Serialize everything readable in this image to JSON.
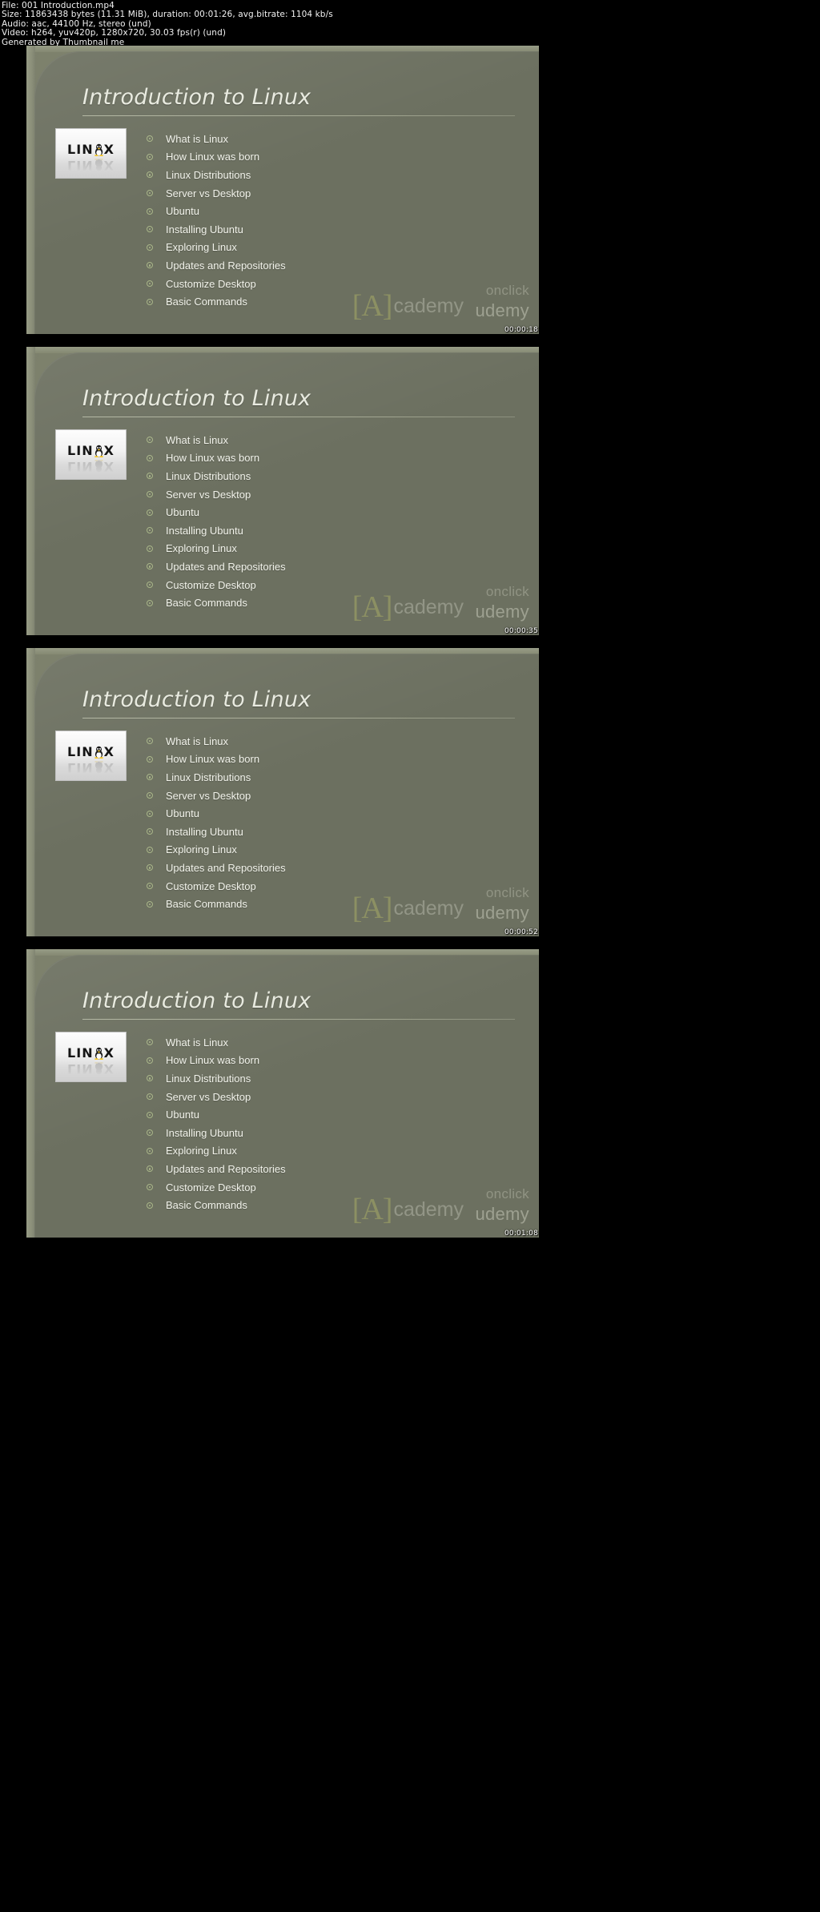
{
  "header": {
    "lines": [
      "File: 001 Introduction.mp4",
      "Size: 11863438 bytes (11.31 MiB), duration: 00:01:26, avg.bitrate: 1104 kb/s",
      "Audio: aac, 44100 Hz, stereo (und)",
      "Video: h264, yuv420p, 1280x720, 30.03 fps(r) (und)",
      "Generated by Thumbnail me"
    ],
    "file_name": "001 Introduction.mp4",
    "size_bytes": "11863438 bytes",
    "size_human": "11.31 MiB",
    "duration": "00:01:26",
    "avg_bitrate": "1104 kb/s",
    "audio_codec": "aac",
    "audio_sample_rate": "44100 Hz",
    "audio_channels": "stereo (und)",
    "video_codec": "h264",
    "pixel_format": "yuv420p",
    "resolution": "1280x720",
    "fps": "30.03 fps(r) (und)",
    "generator": "Generated by Thumbnail me"
  },
  "slide": {
    "title": "Introduction to Linux",
    "logo_word_prefix": "LIN",
    "logo_word_suffix": "X",
    "logo_alt": "linux-logo",
    "bullets": [
      "What is Linux",
      "How Linux was born",
      "Linux Distributions",
      "Server vs Desktop",
      "Ubuntu",
      "Installing Ubuntu",
      "Exploring Linux",
      "Updates and Repositories",
      "Customize Desktop",
      "Basic Commands"
    ]
  },
  "watermark": {
    "academy_bracket_left": "[",
    "academy_bracket_letter": "A",
    "academy_bracket_right": "]",
    "academy_word": "cademy",
    "onclick": "onclick",
    "udemy": "udemy"
  },
  "colors": {
    "slide_background": "#6c7060",
    "slide_frame": "#7c806b",
    "title_text": "#e8eadf",
    "bullet_text": "#f1f2ea",
    "bullet_marker": "#aebb8c",
    "header_background": "#000000",
    "header_text": "#f2f2f2",
    "watermark_accent": "#d8dc6a"
  },
  "thumbnails": [
    {
      "timestamp": "00:00:18"
    },
    {
      "timestamp": "00:00:35"
    },
    {
      "timestamp": "00:00:52"
    },
    {
      "timestamp": "00:01:08"
    }
  ]
}
